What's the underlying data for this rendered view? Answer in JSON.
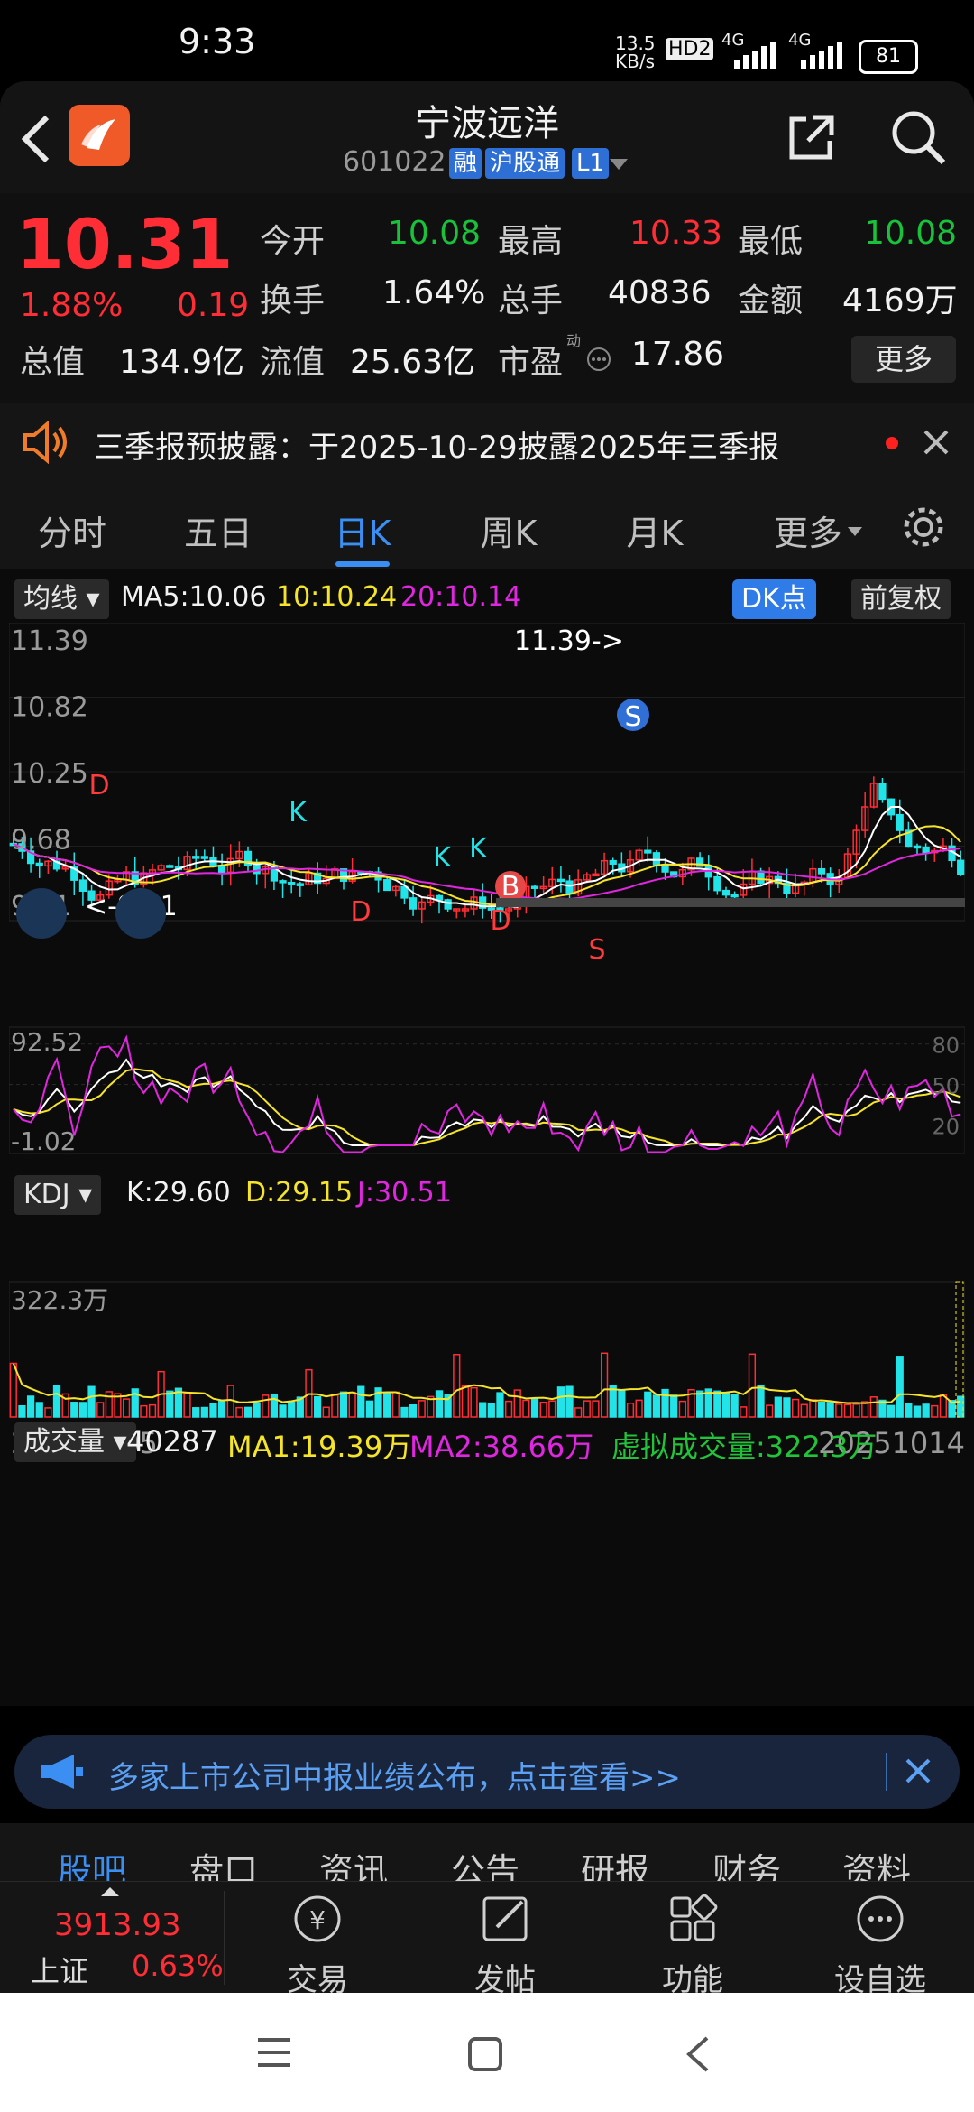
{
  "status": {
    "time": "9:33",
    "net_speed": "13.5\nKB/s",
    "hd": "HD2",
    "sig1": "4G",
    "sig2": "4G",
    "battery": "81"
  },
  "header": {
    "title": "宁波远洋",
    "code": "601022",
    "tags": [
      "融",
      "沪股通",
      "L1"
    ]
  },
  "quote": {
    "price": "10.31",
    "change_pct": "1.88%",
    "change": "0.19",
    "items": [
      {
        "label": "今开",
        "value": "10.08",
        "color": "green"
      },
      {
        "label": "最高",
        "value": "10.33",
        "color": "red"
      },
      {
        "label": "最低",
        "value": "10.08",
        "color": "green"
      },
      {
        "label": "换手",
        "value": "1.64%",
        "color": "white"
      },
      {
        "label": "总手",
        "value": "40836",
        "color": "white"
      },
      {
        "label": "金额",
        "value": "4169万",
        "color": "white"
      },
      {
        "label": "总值",
        "value": "134.9亿",
        "color": "white"
      },
      {
        "label": "流值",
        "value": "25.63亿",
        "color": "white"
      },
      {
        "label": "市盈",
        "value": "17.86",
        "color": "white"
      }
    ],
    "pe_sup": "动",
    "more_label": "更多"
  },
  "notice": {
    "text": "三季报预披露：于2025-10-29披露2025年三季报"
  },
  "tabs": [
    "分时",
    "五日",
    "日K",
    "周K",
    "月K",
    "更多"
  ],
  "active_tab": "日K",
  "kline_header": {
    "selector": "均线",
    "ma5": "MA5:10.06",
    "ma10": "10:10.24",
    "ma20": "20:10.14",
    "dk": "DK点",
    "fq": "前复权"
  },
  "kdj_header": {
    "selector": "KDJ",
    "k": "K:29.60",
    "d": "D:29.15",
    "j": "J:30.51"
  },
  "vol_header": {
    "selector": "成交量",
    "vol": "40287",
    "ma1": "MA1:19.39万",
    "ma2": "MA2:38.66万",
    "virtual": "虚拟成交量:322.3万"
  },
  "chart_data": [
    {
      "type": "candlestick",
      "title": "",
      "y_ticks": [
        "11.39",
        "10.82",
        "10.25",
        "9.68",
        "9.11"
      ],
      "ylim": [
        9.11,
        11.39
      ],
      "annotations": {
        "high": "11.39->",
        "low": "<-9.11"
      },
      "signal_labels": [
        "D",
        "K",
        "K",
        "K",
        "D",
        "D",
        "B",
        "S",
        "S"
      ],
      "ma_legend": [
        {
          "name": "MA5",
          "value": 10.06
        },
        {
          "name": "10",
          "value": 10.24
        },
        {
          "name": "20",
          "value": 10.14
        }
      ],
      "colors": {
        "up": "#ff2d35",
        "down": "#22e4e8",
        "ma5": "#ffffff",
        "ma10": "#f5e42a",
        "ma20": "#e027e0"
      }
    },
    {
      "type": "line",
      "title": "",
      "y_ticks": [
        "92.52",
        "80",
        "50",
        "20",
        "-1.02"
      ],
      "ylim": [
        -1.02,
        92.52
      ],
      "series": [
        {
          "name": "K",
          "last": 29.6
        },
        {
          "name": "D",
          "last": 29.15
        },
        {
          "name": "J",
          "last": 30.51
        }
      ]
    },
    {
      "type": "bar",
      "title": "",
      "y_ticks": [
        "322.3万"
      ],
      "x_range": [
        "20250605",
        "20251014"
      ],
      "series": [
        {
          "name": "MA1",
          "last": "19.39万"
        },
        {
          "name": "MA2",
          "last": "38.66万"
        }
      ]
    }
  ],
  "banner": {
    "text": "多家上市公司中报业绩公布，点击查看>>"
  },
  "subtabs": [
    "股吧",
    "盘口",
    "资讯",
    "公告",
    "研报",
    "财务",
    "资料"
  ],
  "bottom": {
    "index_value": "3913.93",
    "index_name": "上证",
    "index_pct": "0.63%",
    "nav": [
      "交易",
      "发帖",
      "功能",
      "设自选"
    ]
  }
}
